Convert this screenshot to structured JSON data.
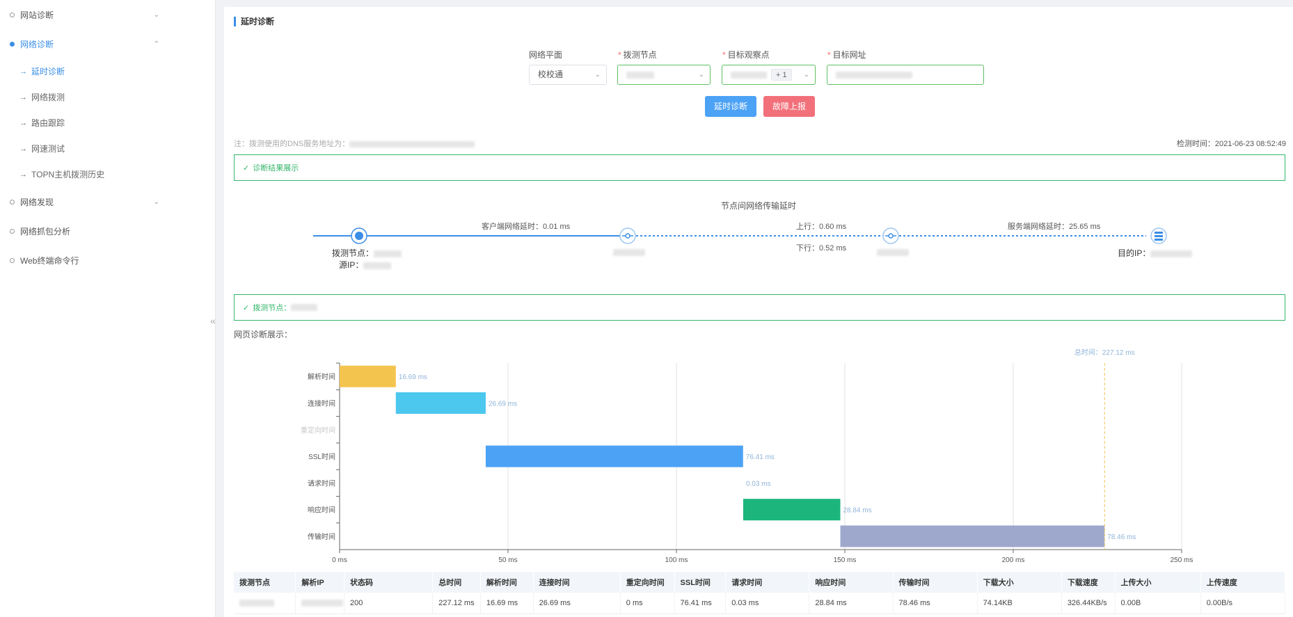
{
  "sidebar": {
    "items": [
      {
        "label": "网站诊断",
        "active": false,
        "chevron": "v"
      },
      {
        "label": "网络诊断",
        "active": true,
        "chevron": "^"
      },
      {
        "label": "网络发现",
        "active": false,
        "chevron": "v"
      },
      {
        "label": "网络抓包分析",
        "active": false
      },
      {
        "label": "Web终端命令行",
        "active": false
      }
    ],
    "subitems": [
      {
        "label": "延时诊断",
        "active": true
      },
      {
        "label": "网络拨测",
        "active": false
      },
      {
        "label": "路由跟踪",
        "active": false
      },
      {
        "label": "网速测试",
        "active": false
      },
      {
        "label": "TOPN主机拨测历史",
        "active": false
      }
    ],
    "collapse_icon": "«"
  },
  "page": {
    "title": "延时诊断"
  },
  "form": {
    "plane_label": "网络平面",
    "plane_value": "校校通",
    "node_label": "拨测节点",
    "observe_label": "目标观察点",
    "observe_tag": "+ 1",
    "url_label": "目标网址",
    "required_mark": "*",
    "diagnose_button": "延时诊断",
    "report_button": "故障上报"
  },
  "note": {
    "text": "注：拨测使用的DNS服务地址为：",
    "check_time": "检测时间：2021-06-23 08:52:49"
  },
  "result": {
    "summary_label": "诊断结果展示",
    "node_label": "拨测节点："
  },
  "path": {
    "title": "节点间网络传输延时",
    "client_latency": "客户端网络延时：0.01 ms",
    "up": "上行：0.60 ms",
    "down": "下行：0.52 ms",
    "server_latency": "服务端网络延时：25.65 ms",
    "node_label": "拨测节点：",
    "src_ip_label": "源IP：",
    "dst_ip_label": "目的IP："
  },
  "chart_title": "网页诊断展示：",
  "chart_data": {
    "type": "bar",
    "subtype": "waterfall",
    "categories": [
      "解析时间",
      "连接时间",
      "重定向时间",
      "SSL时间",
      "请求时间",
      "响应时间",
      "传输时间"
    ],
    "starts": [
      0,
      16.69,
      43.38,
      43.38,
      119.79,
      119.82,
      148.66
    ],
    "values": [
      16.69,
      26.69,
      0,
      76.41,
      0.03,
      28.84,
      78.46
    ],
    "value_labels": [
      "16.69 ms",
      "26.69 ms",
      "",
      "76.41 ms",
      "0.03 ms",
      "28.84 ms",
      "78.46 ms"
    ],
    "colors": [
      "#f3c44e",
      "#4cc7ee",
      "#cccccc",
      "#4ca2f5",
      "#cccccc",
      "#1cb67c",
      "#9ea8cd"
    ],
    "xticks": [
      0,
      50,
      100,
      150,
      200,
      250
    ],
    "xtick_labels": [
      "0 ms",
      "50 ms",
      "100 ms",
      "150 ms",
      "200 ms",
      "250 ms"
    ],
    "xlim": [
      0,
      250
    ],
    "total": 227.12,
    "total_label": "总时间：227.12 ms",
    "grid": true
  },
  "table": {
    "headers": [
      "拨测节点",
      "解析IP",
      "状态码",
      "总时间",
      "解析时间",
      "连接时间",
      "重定向时间",
      "SSL时间",
      "请求时间",
      "响应时间",
      "传输时间",
      "下载大小",
      "下载速度",
      "上传大小",
      "上传速度"
    ],
    "row": [
      "",
      "",
      "200",
      "227.12 ms",
      "16.69 ms",
      "26.69 ms",
      "0 ms",
      "76.41 ms",
      "0.03 ms",
      "28.84 ms",
      "78.46 ms",
      "74.14KB",
      "326.44KB/s",
      "0.00B",
      "0.00B/s"
    ]
  }
}
